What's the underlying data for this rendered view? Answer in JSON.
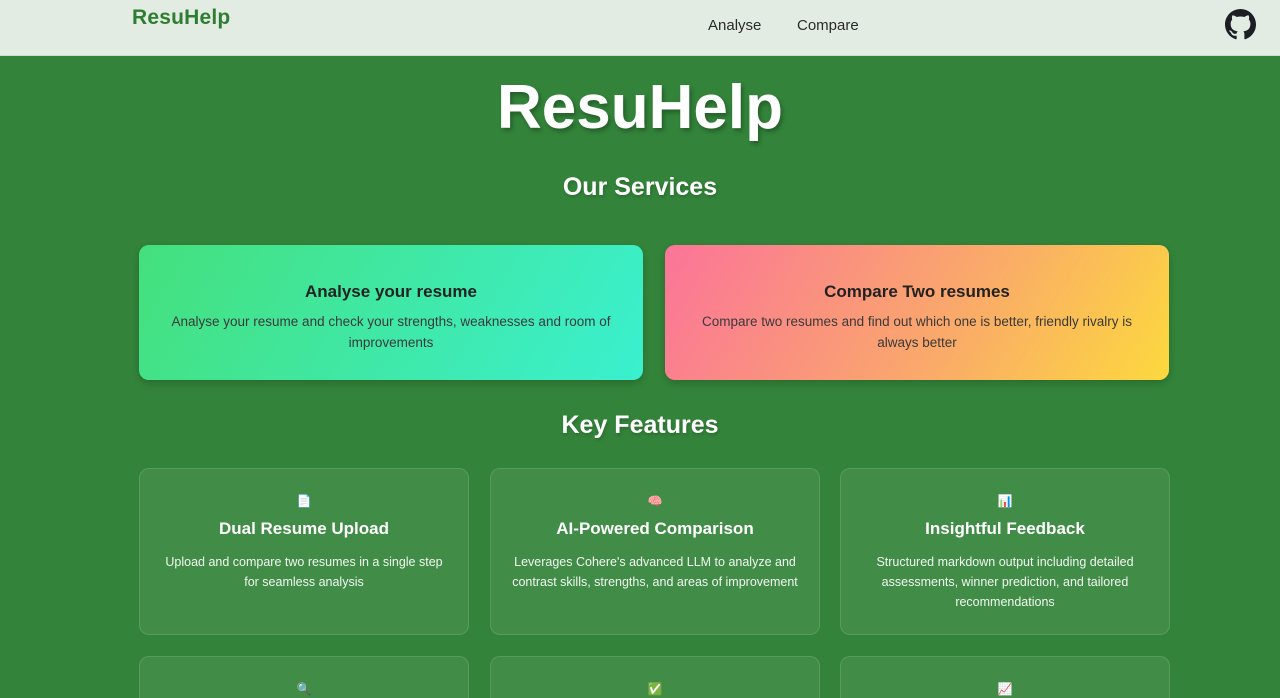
{
  "nav": {
    "brand": "ResuHelp",
    "links": [
      "Analyse",
      "Compare"
    ],
    "github_icon": "github-icon"
  },
  "hero": {
    "title": "ResuHelp"
  },
  "services": {
    "heading": "Our Services",
    "items": [
      {
        "title": "Analyse your resume",
        "description": "Analyse your resume and check your strengths, weaknesses and room of improvements"
      },
      {
        "title": "Compare Two resumes",
        "description": "Compare two resumes and find out which one is better, friendly rivalry is always better"
      }
    ]
  },
  "features": {
    "heading": "Key Features",
    "items": [
      {
        "icon": "📄",
        "icon_name": "document-icon",
        "title": "Dual Resume Upload",
        "description": "Upload and compare two resumes in a single step for seamless analysis"
      },
      {
        "icon": "🧠",
        "icon_name": "brain-icon",
        "title": "AI-Powered Comparison",
        "description": "Leverages Cohere's advanced LLM to analyze and contrast skills, strengths, and areas of improvement"
      },
      {
        "icon": "📊",
        "icon_name": "bar-chart-icon",
        "title": "Insightful Feedback",
        "description": "Structured markdown output including detailed assessments, winner prediction, and tailored recommendations"
      },
      {
        "icon": "🔍",
        "icon_name": "magnifier-icon",
        "title": "",
        "description": ""
      },
      {
        "icon": "✅",
        "icon_name": "checkmark-icon",
        "title": "",
        "description": ""
      },
      {
        "icon": "📈",
        "icon_name": "trend-chart-icon",
        "title": "",
        "description": ""
      }
    ]
  },
  "colors": {
    "background": "#33843a",
    "navbar": "#e2ece2",
    "brand": "#2e7d32"
  }
}
